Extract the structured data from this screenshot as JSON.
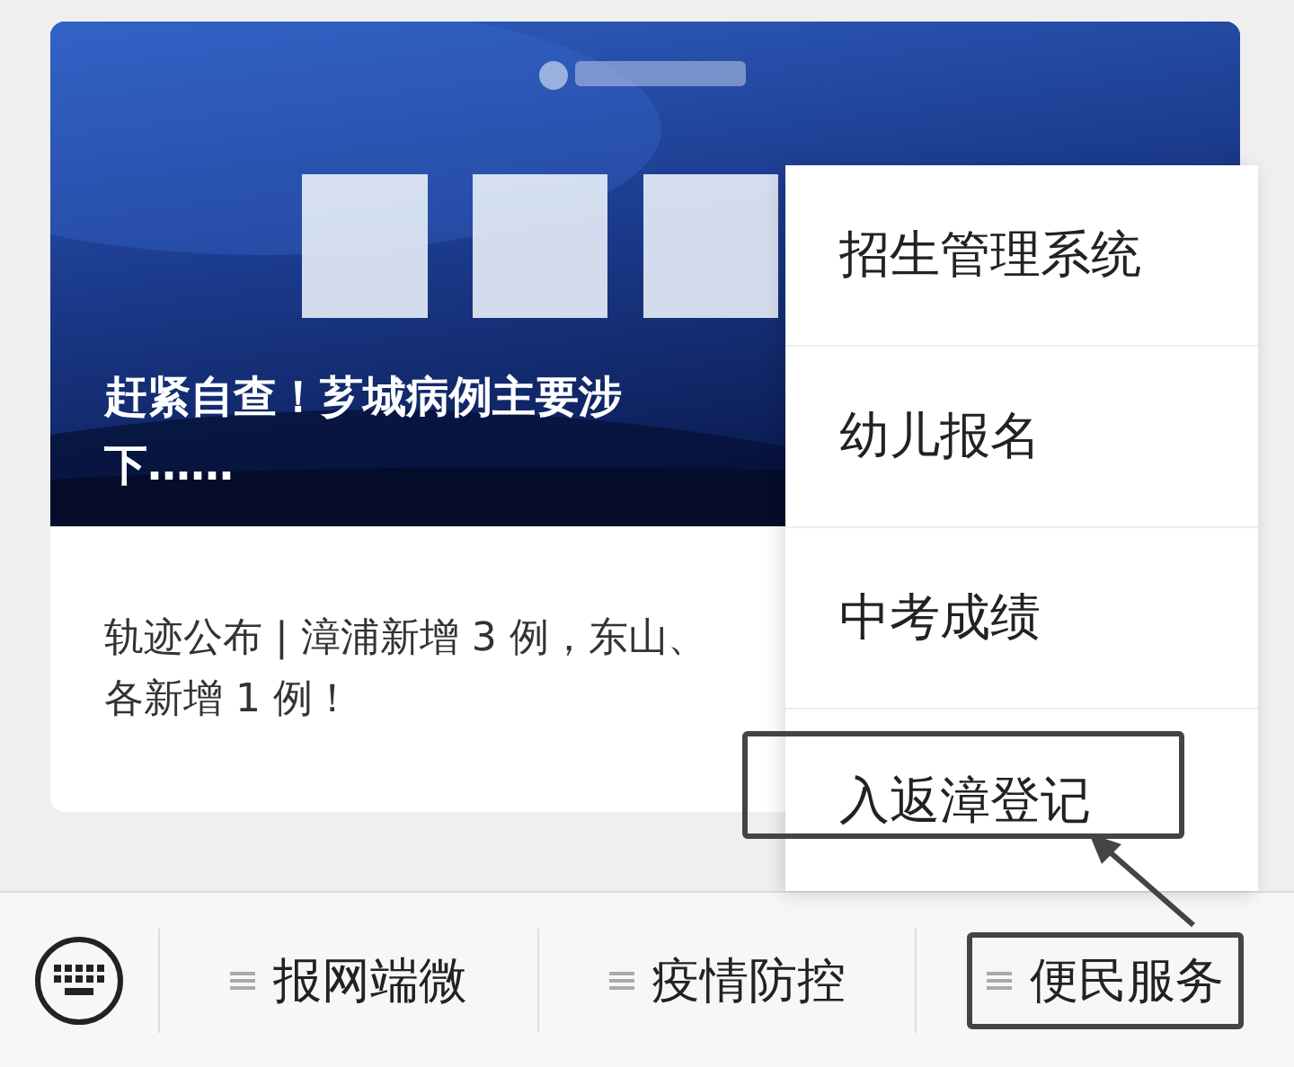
{
  "article": {
    "cover": {
      "kind": "picture"
    },
    "title_lines": [
      "赶紧自查！芗城病例主要涉",
      "下……"
    ],
    "summary_lines": [
      "轨迹公布 | 漳浦新增 3 例，东山、",
      "各新增 1 例！"
    ]
  },
  "menu": {
    "items": [
      {
        "label": "招生管理系统",
        "outlined": false
      },
      {
        "label": "幼儿报名",
        "outlined": false
      },
      {
        "label": "中考成绩",
        "outlined": false
      },
      {
        "label": "入返漳登记",
        "outlined": true
      }
    ]
  },
  "bottom_bar": {
    "tabs": [
      {
        "label": "报网端微",
        "outlined": false
      },
      {
        "label": "疫情防控",
        "outlined": false
      },
      {
        "label": "便民服务",
        "outlined": true
      }
    ]
  }
}
